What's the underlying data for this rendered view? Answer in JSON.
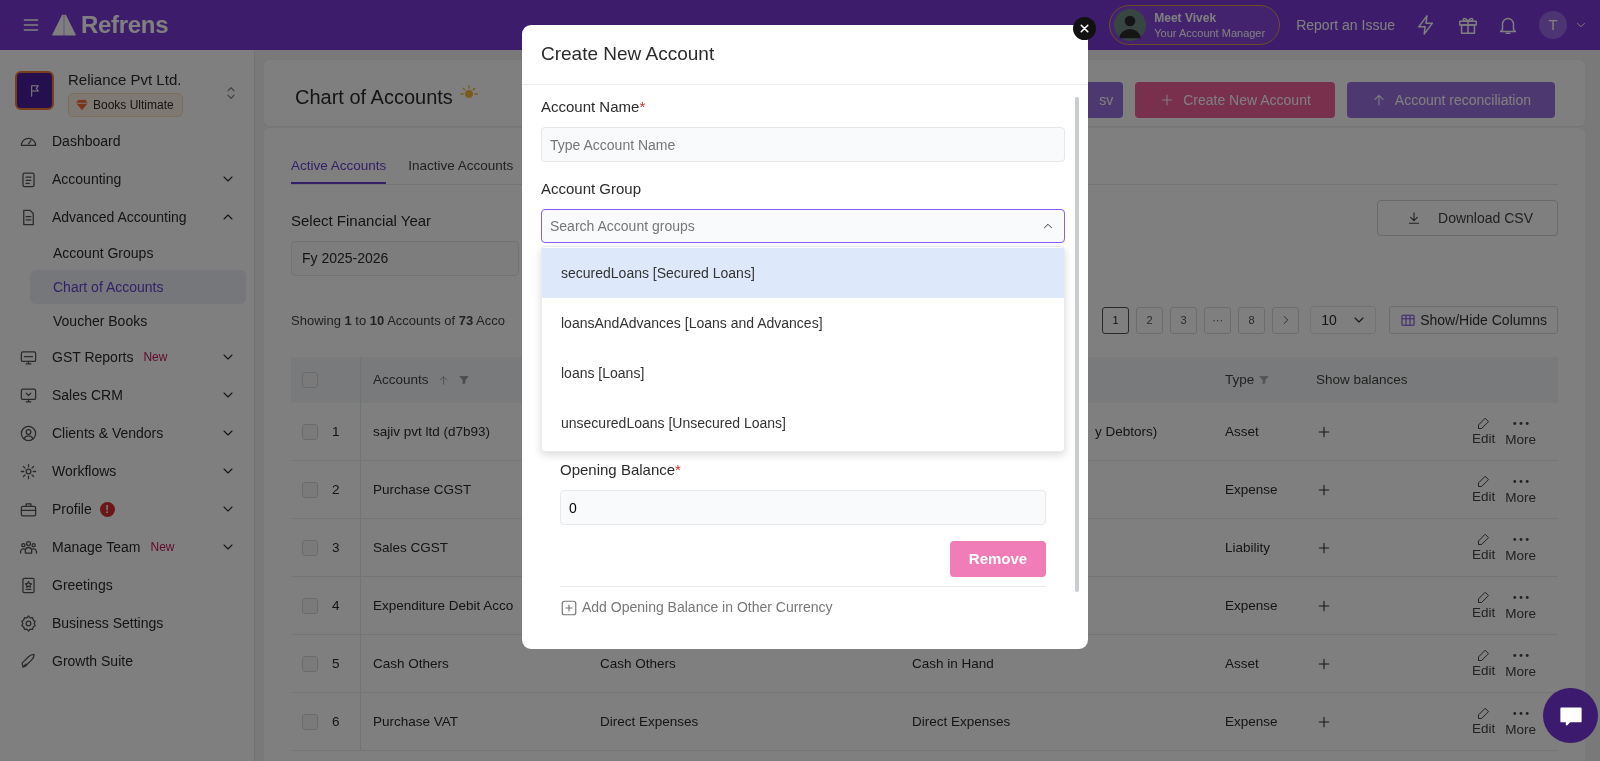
{
  "navbar": {
    "brand": "Refrens",
    "account_manager": {
      "name": "Meet Vivek",
      "role": "Your Account Manager"
    },
    "report_link": "Report an Issue",
    "user_initial": "T"
  },
  "sidebar": {
    "company": {
      "name": "Reliance Pvt Ltd.",
      "plan": "Books Ultimate"
    },
    "items": [
      {
        "label": "Dashboard"
      },
      {
        "label": "Accounting",
        "expanded": false
      },
      {
        "label": "Advanced Accounting",
        "expanded": true,
        "children": [
          {
            "label": "Account Groups",
            "selected": false
          },
          {
            "label": "Chart of Accounts",
            "selected": true
          },
          {
            "label": "Voucher Books",
            "selected": false
          }
        ]
      },
      {
        "label": "GST Reports",
        "badge": "New",
        "expanded": false
      },
      {
        "label": "Sales CRM",
        "expanded": false
      },
      {
        "label": "Clients & Vendors",
        "expanded": false
      },
      {
        "label": "Workflows",
        "expanded": false
      },
      {
        "label": "Profile",
        "alert": "!",
        "expanded": false
      },
      {
        "label": "Manage Team",
        "badge": "New",
        "expanded": false
      },
      {
        "label": "Greetings"
      },
      {
        "label": "Business Settings"
      },
      {
        "label": "Growth Suite"
      }
    ]
  },
  "header": {
    "title": "Chart of Accounts",
    "buttons": [
      {
        "label": "sv",
        "kind": "import"
      },
      {
        "label": "Create New Account",
        "kind": "create"
      },
      {
        "label": "Account reconciliation",
        "kind": "reconcile"
      }
    ]
  },
  "tabs": [
    {
      "label": "Active Accounts",
      "selected": true
    },
    {
      "label": "Inactive Accounts",
      "selected": false
    }
  ],
  "financial_year": {
    "label": "Select Financial Year",
    "value": "Fy 2025-2026"
  },
  "download_button": "Download CSV",
  "summary": "Showing **1** to **10** Accounts of **73** Acco",
  "pagination": {
    "pages": [
      {
        "label": "1",
        "selected": true
      },
      {
        "label": "2",
        "selected": false
      },
      {
        "label": "3",
        "selected": false
      },
      {
        "label": "···",
        "selected": false
      },
      {
        "label": "8",
        "selected": false
      }
    ],
    "page_size": "10",
    "columns_button": "Show/Hide Columns"
  },
  "table": {
    "columns": {
      "accounts": "Accounts",
      "type": "Type",
      "show_balances": "Show balances"
    },
    "select_all_checked": false,
    "rows": [
      {
        "checked": false,
        "number": "1",
        "account": "sajiv pvt ltd (d7b93)",
        "column_4": "y Debtors)",
        "column_4_cut": true,
        "type": "Asset",
        "edit": "Edit",
        "more": "More"
      },
      {
        "checked": false,
        "number": "2",
        "account": "Purchase CGST",
        "type": "Expense",
        "edit": "Edit",
        "more": "More"
      },
      {
        "checked": false,
        "number": "3",
        "account": "Sales CGST",
        "type": "Liability",
        "edit": "Edit",
        "more": "More"
      },
      {
        "checked": false,
        "number": "4",
        "account": "Expenditure Debit Acco",
        "type": "Expense",
        "edit": "Edit",
        "more": "More"
      },
      {
        "checked": false,
        "number": "5",
        "account": "Cash Others",
        "column_3": "Cash Others",
        "column_4": "Cash in Hand",
        "type": "Asset",
        "edit": "Edit",
        "more": "More"
      },
      {
        "checked": false,
        "number": "6",
        "account": "Purchase VAT",
        "column_3": "Direct Expenses",
        "column_4": "Direct Expenses",
        "type": "Expense",
        "edit": "Edit",
        "more": "More"
      }
    ]
  },
  "modal": {
    "title": "Create New Account",
    "account_name": {
      "label": "Account Name",
      "required_mark": "*",
      "placeholder": "Type Account Name"
    },
    "account_group": {
      "label": "Account Group",
      "placeholder": "Search Account groups",
      "expanded": true,
      "options": [
        {
          "label": "securedLoans [Secured Loans]",
          "selected": true
        },
        {
          "label": "loansAndAdvances [Loans and Advances]",
          "selected": false
        },
        {
          "label": "loans [Loans]",
          "selected": false
        },
        {
          "label": "unsecuredLoans [Unsecured Loans]",
          "selected": false
        }
      ]
    },
    "opening_balance": {
      "label": "Opening Balance",
      "required_mark": "*",
      "value": "0"
    },
    "remove_button": "Remove",
    "add_currency_link": "Add Opening Balance in Other Currency"
  }
}
